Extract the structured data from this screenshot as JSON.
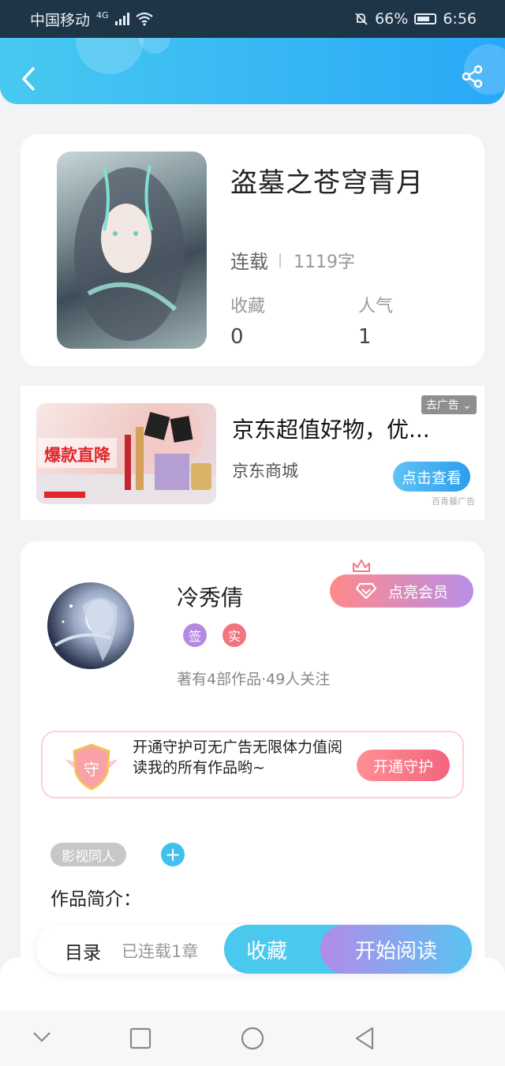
{
  "status_bar": {
    "carrier": "中国移动",
    "network": "4G",
    "battery": "66%",
    "time": "6:56"
  },
  "header": {
    "back_icon": "chevron-left-icon",
    "share_icon": "share-icon"
  },
  "book": {
    "title": "盗墓之苍穹青月",
    "status": "连载",
    "word_count": "1119字",
    "favorites_label": "收藏",
    "favorites_value": "0",
    "popularity_label": "人气",
    "popularity_value": "1"
  },
  "ad": {
    "close_label": "去广告",
    "image_caption": "爆款直降",
    "title": "京东超值好物，优...",
    "source": "京东商城",
    "cta_label": "点击查看",
    "tag": "百青藤广告"
  },
  "author": {
    "name": "冷秀倩",
    "vip_label": "点亮会员",
    "badge_sign": "签",
    "badge_real": "实",
    "meta": "著有4部作品·49人关注",
    "guard_text": "开通守护可无广告无限体力值阅读我的所有作品哟~",
    "guard_shield_char": "守",
    "guard_button": "开通守护",
    "tag": "影视同人",
    "intro_title": "作品简介："
  },
  "bottom_bar": {
    "toc_label": "目录",
    "toc_count": "已连载1章",
    "favorite_label": "收藏",
    "read_label": "开始阅读"
  },
  "colors": {
    "header_start": "#47c9f0",
    "header_end": "#29a8f7",
    "accent_blue": "#4bc8ee",
    "accent_pink": "#ff8f95",
    "badge_purple": "#b38ae0",
    "badge_red": "#f0757e"
  }
}
